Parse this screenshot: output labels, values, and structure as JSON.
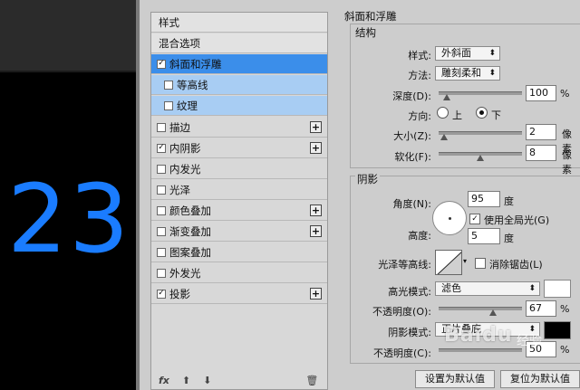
{
  "canvas": {
    "number": "23",
    "color": "#1a7cff"
  },
  "style_list": {
    "items": [
      {
        "label": "样式",
        "type": "header"
      },
      {
        "label": "混合选项",
        "type": "header"
      },
      {
        "label": "斜面和浮雕",
        "checked": true,
        "selected": true
      },
      {
        "label": "等高线",
        "checked": false,
        "sub": true
      },
      {
        "label": "纹理",
        "checked": false,
        "sub": true
      },
      {
        "label": "描边",
        "checked": false,
        "plus": true
      },
      {
        "label": "内阴影",
        "checked": true,
        "plus": true
      },
      {
        "label": "内发光",
        "checked": false
      },
      {
        "label": "光泽",
        "checked": false
      },
      {
        "label": "颜色叠加",
        "checked": false,
        "plus": true
      },
      {
        "label": "渐变叠加",
        "checked": false,
        "plus": true
      },
      {
        "label": "图案叠加",
        "checked": false
      },
      {
        "label": "外发光",
        "checked": false
      },
      {
        "label": "投影",
        "checked": true,
        "plus": true
      }
    ],
    "footer": {
      "fx": "fx",
      "up": "⬆",
      "down": "⬇",
      "trash": "🗑"
    }
  },
  "bevel": {
    "title": "斜面和浮雕",
    "group": "结构",
    "style_label": "样式:",
    "style_value": "外斜面",
    "method_label": "方法:",
    "method_value": "雕刻柔和",
    "depth_label": "深度(D):",
    "depth_value": "100",
    "depth_unit": "%",
    "depth_fraction": 0.06,
    "direction_label": "方向:",
    "dir_up": "上",
    "dir_down": "下",
    "size_label": "大小(Z):",
    "size_value": "2",
    "size_unit": "像素",
    "size_fraction": 0.02,
    "soften_label": "软化(F):",
    "soften_value": "8",
    "soften_unit": "像素",
    "soften_fraction": 0.5
  },
  "shading": {
    "group": "阴影",
    "angle_label": "角度(N):",
    "angle_value": "95",
    "angle_unit": "度",
    "global_light": "使用全局光(G)",
    "altitude_label": "高度:",
    "altitude_value": "5",
    "altitude_unit": "度",
    "gloss_label": "光泽等高线:",
    "antialias": "消除锯齿(L)",
    "highlight_mode_label": "高光模式:",
    "highlight_mode_value": "滤色",
    "highlight_color": "#ffffff",
    "highlight_opacity_label": "不透明度(O):",
    "highlight_opacity_value": "67",
    "highlight_opacity_unit": "%",
    "highlight_opacity_fraction": 0.67,
    "shadow_mode_label": "阴影模式:",
    "shadow_mode_value": "正片叠底",
    "shadow_color": "#000000",
    "shadow_opacity_label": "不透明度(C):",
    "shadow_opacity_value": "50",
    "shadow_opacity_unit": "%"
  },
  "buttons": {
    "make_default": "设置为默认值",
    "reset_default": "复位为默认值"
  },
  "watermark": {
    "brand": "Baidu",
    "sub": "经验"
  }
}
